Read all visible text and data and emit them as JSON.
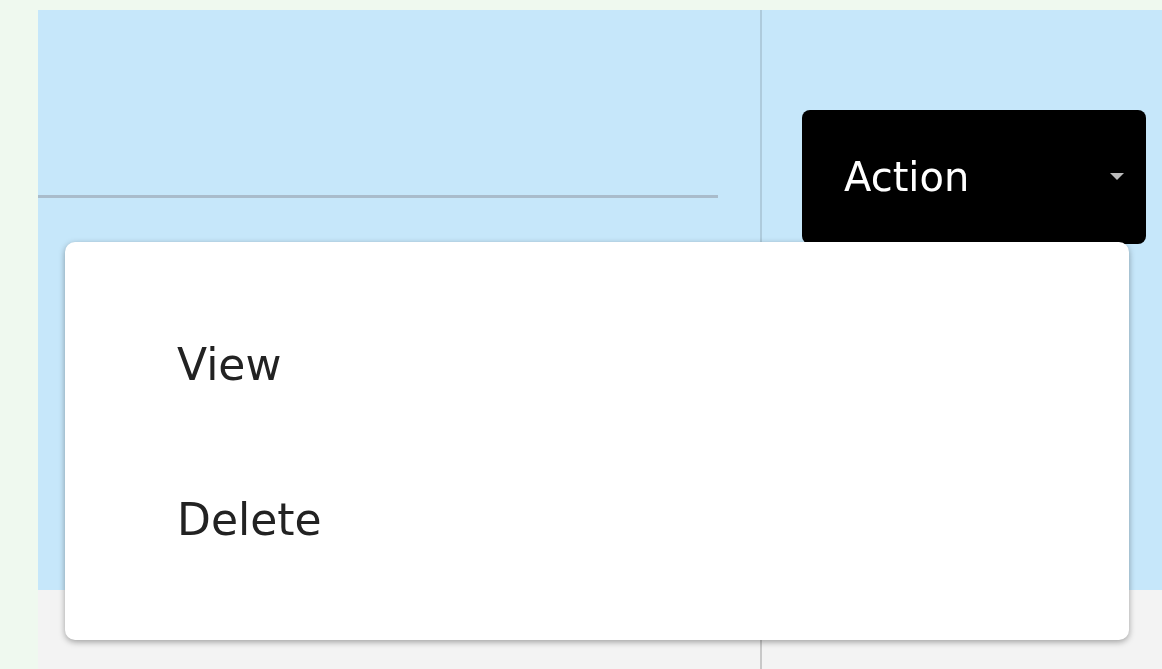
{
  "action_button": {
    "label": "Action"
  },
  "dropdown_menu": {
    "items": [
      {
        "label": "View"
      },
      {
        "label": "Delete"
      }
    ]
  }
}
